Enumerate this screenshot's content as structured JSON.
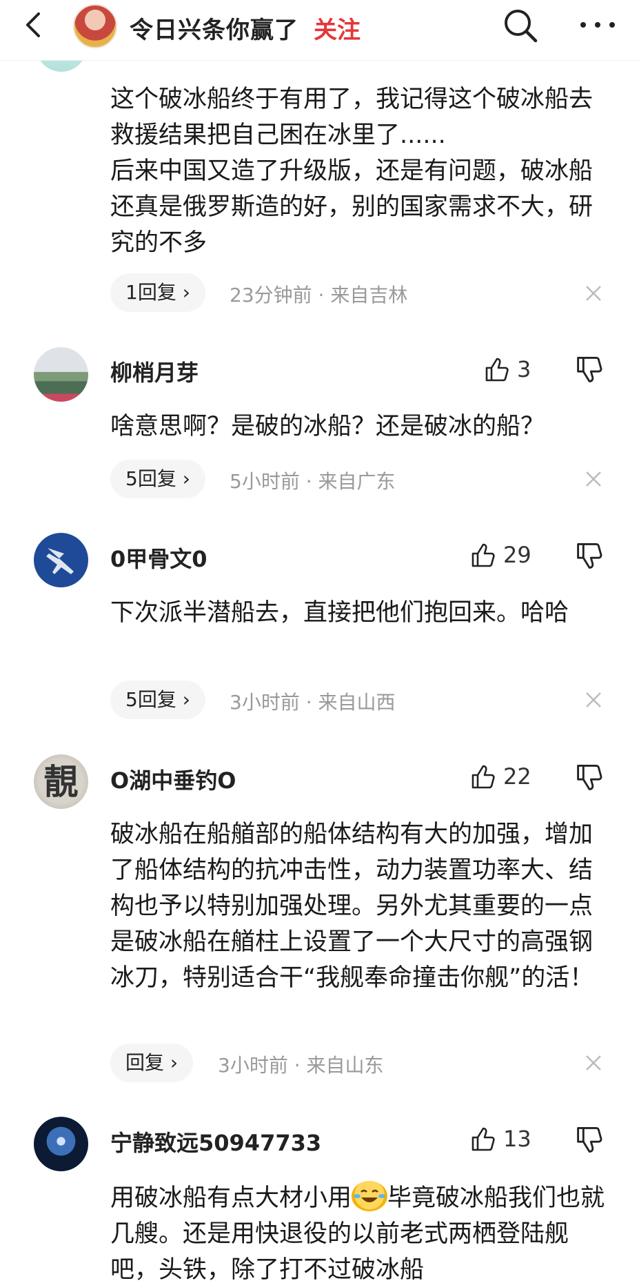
{
  "header": {
    "title": "令日兴条你赢了",
    "follow_label": "关注"
  },
  "comments": [
    {
      "text": "这个破冰船终于有用了，我记得这个破冰船去救援结果把自己困在冰里了......\n后来中国又造了升级版，还是有问题，破冰船还真是俄罗斯造的好，别的国家需求不大，研究的不多",
      "reply_label": "1回复 ›",
      "time": "23分钟前",
      "location": "来自吉林"
    },
    {
      "username": "柳梢月芽",
      "likes": "3",
      "text": "啥意思啊？是破的冰船？还是破冰的船？",
      "reply_label": "5回复 ›",
      "time": "5小时前",
      "location": "来自广东"
    },
    {
      "username": "0甲骨文0",
      "likes": "29",
      "text": "下次派半潜船去，直接把他们抱回来。哈哈",
      "reply_label": "5回复 ›",
      "time": "3小时前",
      "location": "来自山西"
    },
    {
      "username": "O湖中垂钓O",
      "likes": "22",
      "avatar_char": "靚",
      "text": "破冰船在船艏部的船体结构有大的加强，增加了船体结构的抗冲击性，动力装置功率大、结构也予以特别加强处理。另外尤其重要的一点是破冰船在艏柱上设置了一个大尺寸的高强钢冰刀，特别适合干“我舰奉命撞击你舰”的活！",
      "reply_label": "回复 ›",
      "time": "3小时前",
      "location": "来自山东"
    },
    {
      "username": "宁静致远50947733",
      "likes": "13",
      "text_before_emoji": "用破冰船有点大材小用",
      "emoji": "laughing-crying",
      "text_after_emoji": "毕竟破冰船我们也就几艘。还是用快退役的以前老式两栖登陆舰吧，头铁，除了打不过破冰船"
    }
  ],
  "separator": " · ",
  "colors": {
    "follow": "#e6353a",
    "meta": "#999999",
    "pill_bg": "#f5f5f5"
  }
}
